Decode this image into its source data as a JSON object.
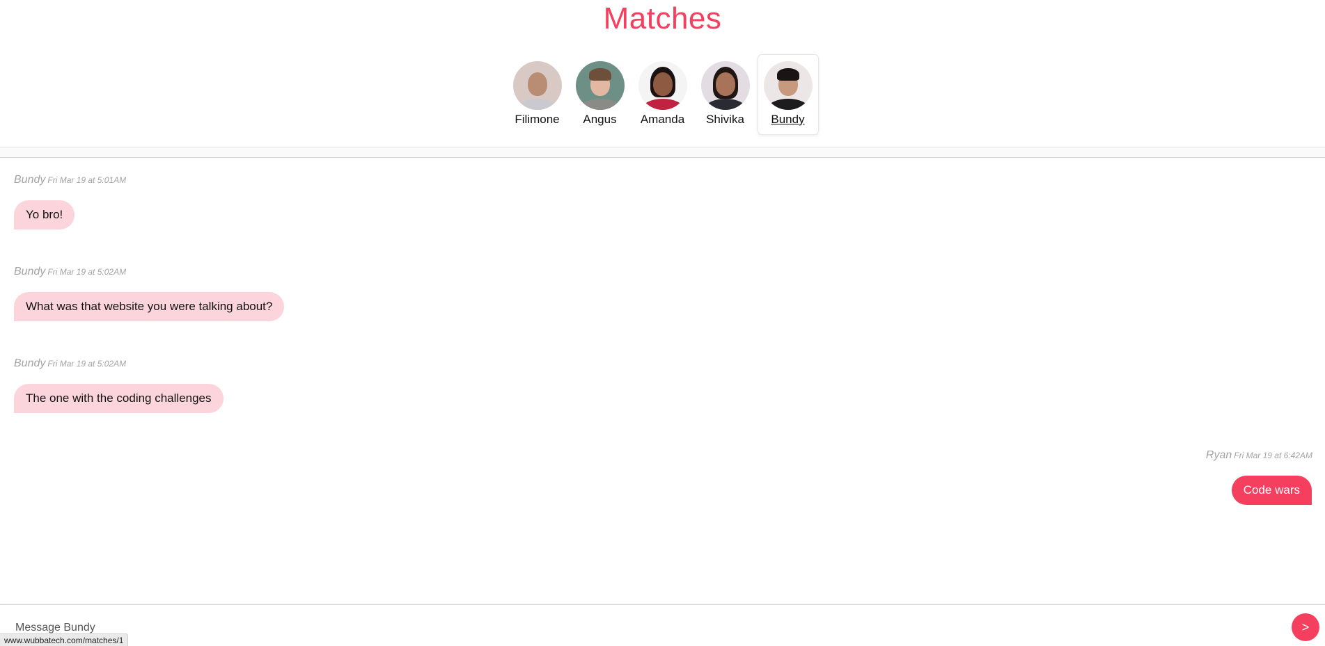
{
  "page": {
    "title": "Matches"
  },
  "colors": {
    "accent": "#f43f5e",
    "incoming_bubble": "#fcd4dc",
    "meta_text": "#a3a3a3"
  },
  "matches": [
    {
      "name": "Filimone",
      "active": false
    },
    {
      "name": "Angus",
      "active": false
    },
    {
      "name": "Amanda",
      "active": false
    },
    {
      "name": "Shivika",
      "active": false
    },
    {
      "name": "Bundy",
      "active": true
    }
  ],
  "conversation": {
    "messages": [
      {
        "sender": "Bundy",
        "time": "Fri Mar 19 at 5:01AM",
        "text": "Yo bro!",
        "from_me": false
      },
      {
        "sender": "Bundy",
        "time": "Fri Mar 19 at 5:02AM",
        "text": "What was that website you were talking about?",
        "from_me": false
      },
      {
        "sender": "Bundy",
        "time": "Fri Mar 19 at 5:02AM",
        "text": "The one with the coding challenges",
        "from_me": false
      },
      {
        "sender": "Ryan",
        "time": "Fri Mar 19 at 6:42AM",
        "text": "Code wars",
        "from_me": true
      }
    ]
  },
  "composer": {
    "placeholder": "Message Bundy",
    "value": "",
    "send_label": ">",
    "send_icon": "send-arrow-icon"
  },
  "status_bar": {
    "url": "www.wubbatech.com/matches/1"
  }
}
